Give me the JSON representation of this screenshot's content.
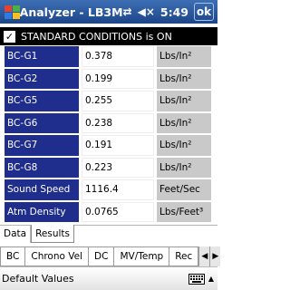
{
  "title": {
    "app_name": "Analyzer - LB3M",
    "clock": "5:49",
    "ok": "ok"
  },
  "conditions": {
    "checked": true,
    "label": "STANDARD CONDITIONS is ON"
  },
  "rows": [
    {
      "label": "BC-G1",
      "value": "0.378",
      "unit": "Lbs/In²"
    },
    {
      "label": "BC-G2",
      "value": "0.199",
      "unit": "Lbs/In²"
    },
    {
      "label": "BC-G5",
      "value": "0.255",
      "unit": "Lbs/In²"
    },
    {
      "label": "BC-G6",
      "value": "0.238",
      "unit": "Lbs/In²"
    },
    {
      "label": "BC-G7",
      "value": "0.191",
      "unit": "Lbs/In²"
    },
    {
      "label": "BC-G8",
      "value": "0.223",
      "unit": "Lbs/In²"
    },
    {
      "label": "Sound Speed",
      "value": "1116.4",
      "unit": "Feet/Sec"
    },
    {
      "label": "Atm Density",
      "value": "0.0765",
      "unit": "Lbs/Feet³"
    }
  ],
  "view_tabs": [
    {
      "label": "Data",
      "active": false
    },
    {
      "label": "Results",
      "active": true
    }
  ],
  "result_tabs": [
    {
      "label": "BC",
      "active": true
    },
    {
      "label": "Chrono Vel",
      "active": false
    },
    {
      "label": "DC",
      "active": false
    },
    {
      "label": "MV/Temp",
      "active": false
    },
    {
      "label": "Rec",
      "active": false
    }
  ],
  "bottom": {
    "left_label": "Default Values"
  },
  "icons": {
    "windows": "windows-flag-icon",
    "connectivity": "connectivity-icon",
    "volume": "volume-icon",
    "keyboard": "keyboard-icon"
  }
}
